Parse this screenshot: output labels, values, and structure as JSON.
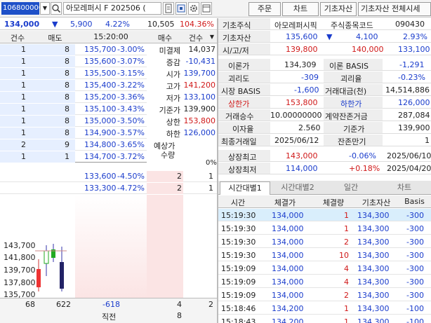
{
  "toolbar": {
    "code": "106800000",
    "name": "아모레퍼시 F 202506 (",
    "tabs": [
      "주문",
      "차트",
      "기초자산",
      "기초자산 전체시세"
    ]
  },
  "summary": {
    "price": "134,000",
    "arrow": "▼",
    "change": "5,900",
    "rate": "4.22%",
    "volume": "10,505",
    "volume_rate": "104.36%"
  },
  "orderbook": {
    "headers": [
      "건수",
      "매도",
      "15:20:00",
      "매수",
      "건수"
    ],
    "asks": [
      {
        "cnt": "1",
        "qty": "8",
        "price": "135,700",
        "rate": "-3.00%"
      },
      {
        "cnt": "1",
        "qty": "8",
        "price": "135,600",
        "rate": "-3.07%"
      },
      {
        "cnt": "1",
        "qty": "8",
        "price": "135,500",
        "rate": "-3.15%"
      },
      {
        "cnt": "1",
        "qty": "8",
        "price": "135,400",
        "rate": "-3.22%"
      },
      {
        "cnt": "1",
        "qty": "8",
        "price": "135,200",
        "rate": "-3.36%"
      },
      {
        "cnt": "1",
        "qty": "8",
        "price": "135,100",
        "rate": "-3.43%"
      },
      {
        "cnt": "1",
        "qty": "8",
        "price": "135,000",
        "rate": "-3.50%"
      },
      {
        "cnt": "1",
        "qty": "8",
        "price": "134,900",
        "rate": "-3.57%"
      },
      {
        "cnt": "2",
        "qty": "9",
        "price": "134,800",
        "rate": "-3.65%"
      },
      {
        "cnt": "1",
        "qty": "1",
        "price": "134,700",
        "rate": "-3.72%"
      }
    ],
    "bids": [
      {
        "price": "133,600",
        "rate": "-4.50%",
        "qty": "2",
        "cnt": "1"
      },
      {
        "price": "133,300",
        "rate": "-4.72%",
        "qty": "2",
        "cnt": "1"
      }
    ],
    "info": [
      {
        "label": "미결제",
        "value": "14,037"
      },
      {
        "label": "증감",
        "value": "-10,431"
      },
      {
        "label": "시가",
        "value": "139,700"
      },
      {
        "label": "고가",
        "value": "141,200"
      },
      {
        "label": "저가",
        "value": "133,100"
      },
      {
        "label": "기준가",
        "value": "139,900"
      },
      {
        "label": "상한",
        "value": "153,800"
      },
      {
        "label": "하한",
        "value": "126,000"
      }
    ],
    "expected_label": "예상가",
    "expected_qty_label": "수량",
    "zero_pct": "0%",
    "chart_ticks": [
      "143,700",
      "141,800",
      "139,700",
      "137,800",
      "135,700"
    ],
    "footer": {
      "ask_cnt": "68",
      "ask_qty": "622",
      "diff": "-618",
      "bid_qty": "4",
      "bid_cnt": "2",
      "close_label": "직전",
      "close_val": "8"
    }
  },
  "info_grid": [
    {
      "l1": "기초주식",
      "v1": "아모레퍼시픽",
      "l2": "주식종목코드",
      "v2": "090430"
    },
    {
      "l1": "기초자산",
      "v1": "135,600",
      "v1b": "▼",
      "v1c": "4,100",
      "v2": "2.93%"
    },
    {
      "l1": "시/고/저",
      "v1": "139,800",
      "v1c": "140,000",
      "v2": "133,100"
    },
    {
      "l1": "이론가",
      "v1": "134,309",
      "l2": "이론 BASIS",
      "v2": "-1,291"
    },
    {
      "l1": "괴리도",
      "v1": "-309",
      "l2": "괴리율",
      "v2": "-0.23%"
    },
    {
      "l1": "시장 BASIS",
      "v1": "-1,600",
      "l2": "거래대금(천)",
      "v2": "14,514,886"
    },
    {
      "l1": "상한가",
      "v1": "153,800",
      "l2": "하한가",
      "v2": "126,000"
    },
    {
      "l1": "거래승수",
      "v1": "10.00000000",
      "l2": "계약잔존거금",
      "v2": "287,084"
    },
    {
      "l1": "이자율",
      "v1": "2.560",
      "l2": "기준가",
      "v2": "139,900"
    },
    {
      "l1": "최종거래일",
      "v1": "2025/06/12",
      "l2": "잔존만기",
      "v2": "1"
    },
    {
      "l1": "상장최고",
      "v1": "143,000",
      "v1c": "-0.06%",
      "v2": "2025/06/10"
    },
    {
      "l1": "상장최저",
      "v1": "114,000",
      "v1c": "+0.18%",
      "v2": "2025/04/20"
    }
  ],
  "time_tabs": [
    "시간대별1",
    "시간대별2",
    "일간",
    "차트"
  ],
  "trade_headers": [
    "시간",
    "체결가",
    "체결량",
    "기초자산",
    "Basis"
  ],
  "trades": [
    {
      "time": "15:19:30",
      "price": "134,000",
      "qty": "1",
      "base": "134,300",
      "basis": "-300"
    },
    {
      "time": "15:19:30",
      "price": "134,000",
      "qty": "1",
      "base": "134,300",
      "basis": "-300"
    },
    {
      "time": "15:19:30",
      "price": "134,000",
      "qty": "2",
      "base": "134,300",
      "basis": "-300"
    },
    {
      "time": "15:19:30",
      "price": "134,000",
      "qty": "10",
      "base": "134,300",
      "basis": "-300"
    },
    {
      "time": "15:19:09",
      "price": "134,000",
      "qty": "4",
      "base": "134,300",
      "basis": "-300"
    },
    {
      "time": "15:19:09",
      "price": "134,000",
      "qty": "4",
      "base": "134,300",
      "basis": "-300"
    },
    {
      "time": "15:19:09",
      "price": "134,000",
      "qty": "2",
      "base": "134,300",
      "basis": "-300"
    },
    {
      "time": "15:18:46",
      "price": "134,200",
      "qty": "1",
      "base": "134,300",
      "basis": "-100"
    },
    {
      "time": "15:18:43",
      "price": "134,200",
      "qty": "1",
      "base": "134,300",
      "basis": "-100"
    }
  ]
}
